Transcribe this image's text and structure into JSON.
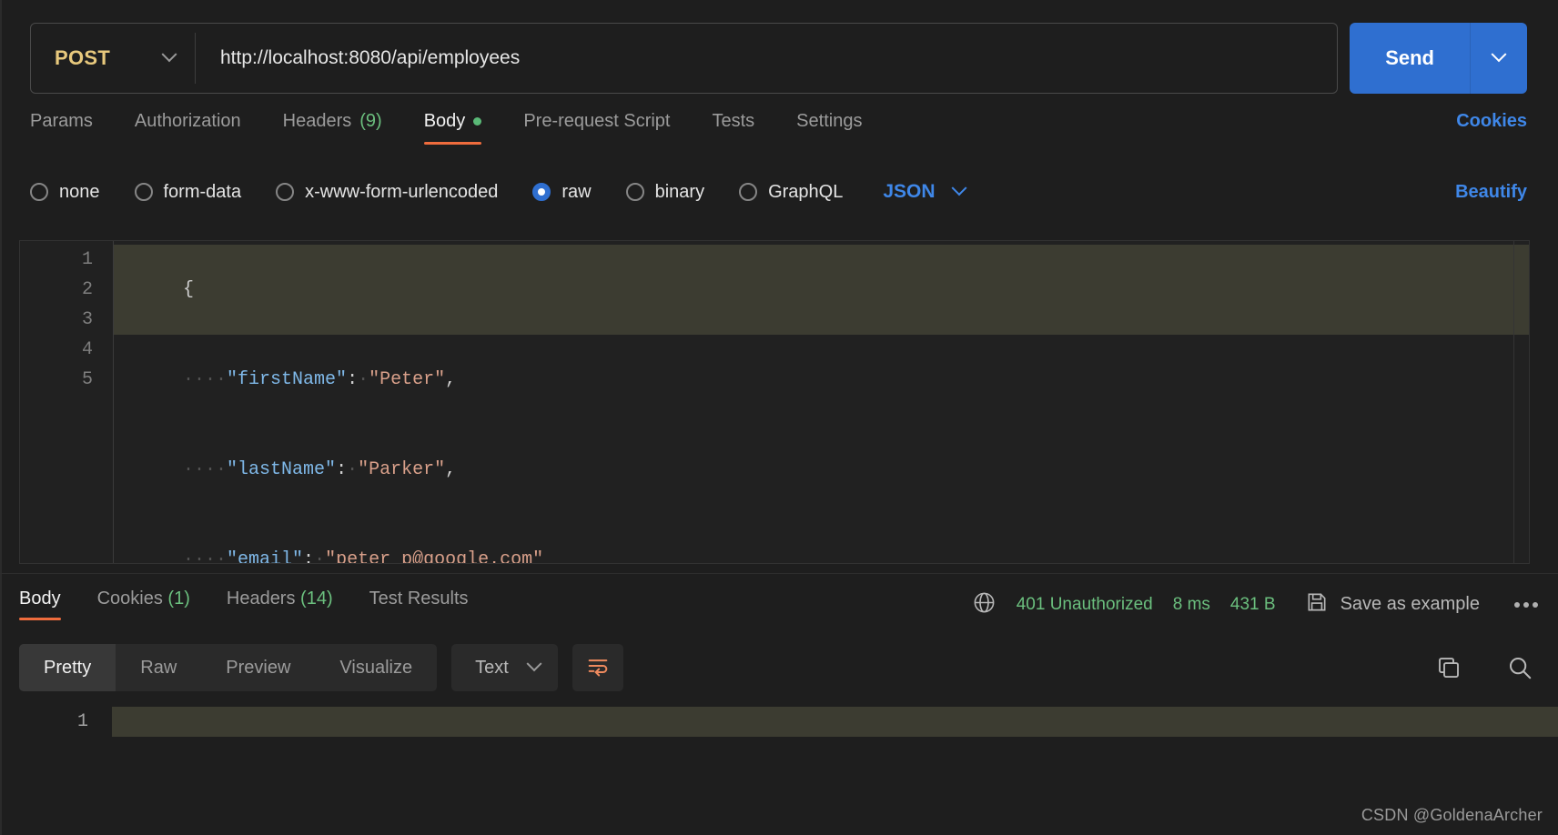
{
  "request": {
    "method": "POST",
    "url": "http://localhost:8080/api/employees",
    "send_label": "Send",
    "tabs": [
      {
        "label": "Params",
        "count": "",
        "active": false,
        "dot": false
      },
      {
        "label": "Authorization",
        "count": "",
        "active": false,
        "dot": false
      },
      {
        "label": "Headers",
        "count": "(9)",
        "active": false,
        "dot": false
      },
      {
        "label": "Body",
        "count": "",
        "active": true,
        "dot": true
      },
      {
        "label": "Pre-request Script",
        "count": "",
        "active": false,
        "dot": false
      },
      {
        "label": "Tests",
        "count": "",
        "active": false,
        "dot": false
      },
      {
        "label": "Settings",
        "count": "",
        "active": false,
        "dot": false
      }
    ],
    "cookies_link": "Cookies",
    "body_types": [
      {
        "label": "none",
        "selected": false
      },
      {
        "label": "form-data",
        "selected": false
      },
      {
        "label": "x-www-form-urlencoded",
        "selected": false
      },
      {
        "label": "raw",
        "selected": true
      },
      {
        "label": "binary",
        "selected": false
      },
      {
        "label": "GraphQL",
        "selected": false
      }
    ],
    "raw_format": "JSON",
    "beautify_label": "Beautify"
  },
  "editor": {
    "line_numbers": [
      "1",
      "2",
      "3",
      "4",
      "5"
    ],
    "lines": [
      {
        "highlighted": true,
        "tokens": [
          {
            "t": "punct",
            "v": "{"
          }
        ]
      },
      {
        "highlighted": false,
        "tokens": [
          {
            "t": "ws",
            "v": "····"
          },
          {
            "t": "key",
            "v": "\"firstName\""
          },
          {
            "t": "punct",
            "v": ":"
          },
          {
            "t": "ws",
            "v": "·"
          },
          {
            "t": "str",
            "v": "\"Peter\""
          },
          {
            "t": "punct",
            "v": ","
          }
        ]
      },
      {
        "highlighted": false,
        "tokens": [
          {
            "t": "ws",
            "v": "····"
          },
          {
            "t": "key",
            "v": "\"lastName\""
          },
          {
            "t": "punct",
            "v": ":"
          },
          {
            "t": "ws",
            "v": "·"
          },
          {
            "t": "str",
            "v": "\"Parker\""
          },
          {
            "t": "punct",
            "v": ","
          }
        ]
      },
      {
        "highlighted": false,
        "tokens": [
          {
            "t": "ws",
            "v": "····"
          },
          {
            "t": "key",
            "v": "\"email\""
          },
          {
            "t": "punct",
            "v": ":"
          },
          {
            "t": "ws",
            "v": "·"
          },
          {
            "t": "str",
            "v": "\"peter_p@google.com\""
          }
        ]
      },
      {
        "highlighted": false,
        "tokens": [
          {
            "t": "punct",
            "v": "}"
          }
        ]
      }
    ],
    "body_text": "{\n    \"firstName\": \"Peter\",\n    \"lastName\": \"Parker\",\n    \"email\": \"peter_p@google.com\"\n}"
  },
  "response": {
    "tabs": [
      {
        "label": "Body",
        "count": "",
        "active": true
      },
      {
        "label": "Cookies",
        "count": "(1)",
        "active": false
      },
      {
        "label": "Headers",
        "count": "(14)",
        "active": false
      },
      {
        "label": "Test Results",
        "count": "",
        "active": false
      }
    ],
    "status": "401 Unauthorized",
    "time": "8 ms",
    "size": "431 B",
    "save_as_example": "Save as example",
    "view_modes": [
      {
        "label": "Pretty",
        "active": true
      },
      {
        "label": "Raw",
        "active": false
      },
      {
        "label": "Preview",
        "active": false
      },
      {
        "label": "Visualize",
        "active": false
      }
    ],
    "format": "Text",
    "line_numbers": [
      "1"
    ],
    "body_text": ""
  },
  "colors": {
    "accent_orange": "#ef6c3d",
    "link_blue": "#3f87e8",
    "send_blue": "#2f6fd0",
    "status_green": "#6bbf7e",
    "method_yellow": "#e8c97d"
  },
  "watermark": "CSDN @GoldenaArcher"
}
